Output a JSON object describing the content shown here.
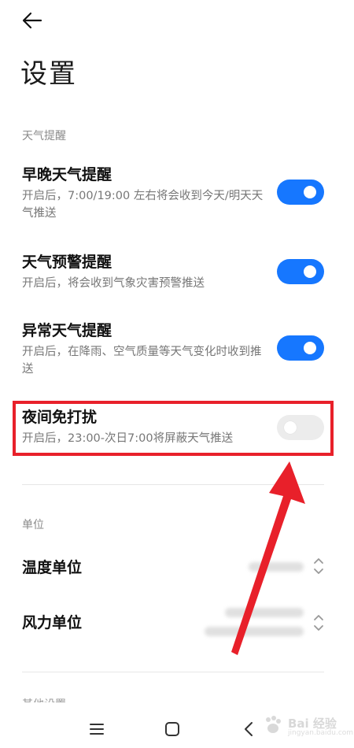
{
  "header": {
    "back_icon": "arrow-left-icon",
    "title": "设置"
  },
  "sections": {
    "weather_alert": {
      "label": "天气提醒",
      "items": [
        {
          "title": "早晚天气提醒",
          "desc": "开启后，7:00/19:00 左右将会收到今天/明天天气推送",
          "on": true
        },
        {
          "title": "天气预警提醒",
          "desc": "开启后，将会收到气象灾害预警推送",
          "on": true
        },
        {
          "title": "异常天气提醒",
          "desc": "开启后，在降雨、空气质量等天气变化时收到推送",
          "on": true
        },
        {
          "title": "夜间免打扰",
          "desc": "开启后，23:00-次日7:00将屏蔽天气推送",
          "on": false
        }
      ]
    },
    "units": {
      "label": "单位",
      "items": [
        {
          "title": "温度单位",
          "icon": "chevron-updown-icon"
        },
        {
          "title": "风力单位",
          "icon": "chevron-updown-icon"
        }
      ]
    },
    "other": {
      "label": "其他设置"
    }
  },
  "nav_bar": {
    "icons": [
      "menu-icon",
      "home-icon",
      "back-icon"
    ]
  },
  "colors": {
    "accent": "#1677ff",
    "toggle_off": "#ececec",
    "annotation": "#e8202a"
  },
  "annotation": {
    "target": "夜间免打扰"
  },
  "watermark": {
    "text": "Bai 经验",
    "sub": "jingyan.baidu.com"
  }
}
